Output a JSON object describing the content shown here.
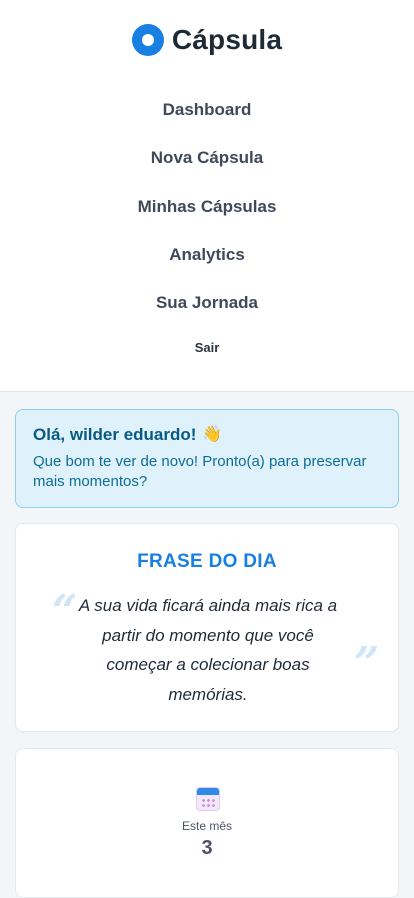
{
  "brand": {
    "name": "Cápsula",
    "logo_icon": "circle-ring-logo-icon",
    "accent": "#1a7fe3"
  },
  "nav": {
    "items": [
      {
        "label": "Dashboard"
      },
      {
        "label": "Nova Cápsula"
      },
      {
        "label": "Minhas Cápsulas"
      },
      {
        "label": "Analytics"
      },
      {
        "label": "Sua Jornada"
      },
      {
        "label": "Sair"
      }
    ]
  },
  "welcome": {
    "title": "Olá, wilder eduardo!",
    "title_icon": "waving-hand-icon",
    "subtitle": "Que bom te ver de novo! Pronto(a) para preservar mais momentos?"
  },
  "quote": {
    "title": "FRASE DO DIA",
    "text": "A sua vida ficará ainda mais rica a partir do momento que você começar a colecionar boas memórias.",
    "open_mark": "“",
    "close_mark": "”"
  },
  "stats": {
    "icon": "calendar-icon",
    "label": "Este mês",
    "value": "3"
  }
}
